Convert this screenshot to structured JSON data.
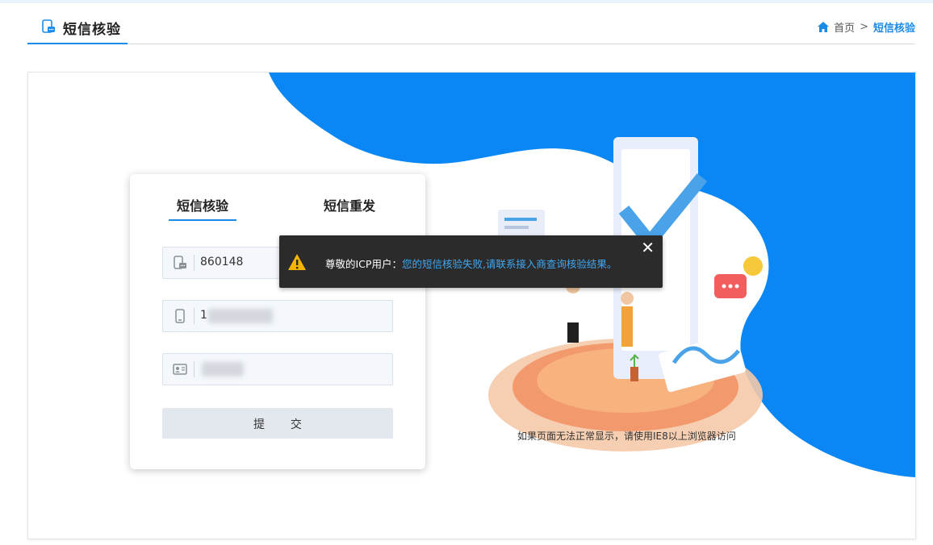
{
  "header": {
    "title": "短信核验",
    "breadcrumb": {
      "home": "首页",
      "separator": ">",
      "current": "短信核验"
    }
  },
  "form": {
    "tabs": [
      {
        "label": "短信核验"
      },
      {
        "label": "短信重发"
      }
    ],
    "verify_code_value": "860148",
    "phone_value": "1",
    "submit_label": "提 交"
  },
  "hint": "如果页面无法正常显示，请使用IE8以上浏览器访问",
  "alert": {
    "label": "尊敬的ICP用户：",
    "message": "您的短信核验失败,请联系接入商查询核验结果。",
    "close_glyph": "✕"
  },
  "colors": {
    "accent": "#1c8be6",
    "brand_blue": "#0a87f5",
    "alert_bg": "#2b2b2b",
    "alert_message": "#3fa9f5",
    "warning": "#f5b400"
  },
  "icons": {
    "title": "sms-phone-icon",
    "home": "home-icon",
    "code_field": "sms-phone-icon",
    "phone_field": "mobile-phone-icon",
    "id_field": "id-card-icon",
    "alert": "warning-icon",
    "close": "close-icon"
  }
}
